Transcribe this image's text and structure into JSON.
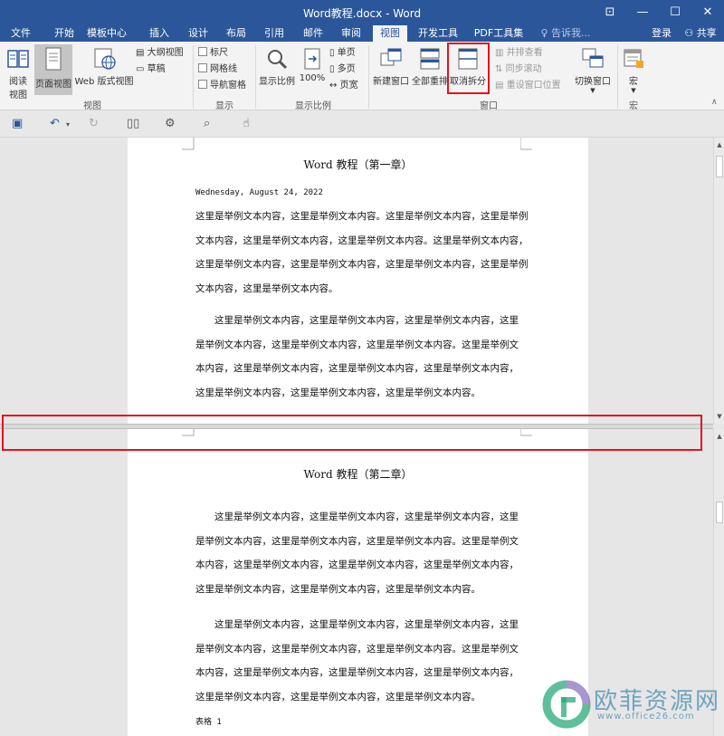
{
  "window": {
    "title": "Word教程.docx - Word",
    "controls": [
      "⊡",
      "—",
      "☐",
      "✕"
    ]
  },
  "tabs": [
    {
      "label": "文件"
    },
    {
      "label": "开始"
    },
    {
      "label": "模板中心"
    },
    {
      "label": "插入"
    },
    {
      "label": "设计"
    },
    {
      "label": "布局"
    },
    {
      "label": "引用"
    },
    {
      "label": "邮件"
    },
    {
      "label": "审阅"
    },
    {
      "label": "视图"
    },
    {
      "label": "开发工具"
    },
    {
      "label": "PDF工具集"
    }
  ],
  "tell_me": "告诉我...",
  "login": "登录",
  "share": "共享",
  "ribbon": {
    "views": {
      "read_mode": "阅读\n视图",
      "read_mode_l1": "阅读",
      "read_mode_l2": "视图",
      "print_layout": "页面视图",
      "web_layout": "Web 版式视图",
      "outline": "大纲视图",
      "draft": "草稿",
      "group": "视图"
    },
    "show": {
      "ruler": "标尺",
      "gridlines": "网格线",
      "nav_pane": "导航窗格",
      "group": "显示"
    },
    "zoom": {
      "zoom": "显示比例",
      "hundred": "100%",
      "one_page": "单页",
      "multi_page": "多页",
      "page_width": "页宽",
      "group": "显示比例"
    },
    "window": {
      "new_window": "新建窗口",
      "arrange_all": "全部重排",
      "remove_split": "取消拆分",
      "side_by_side": "并排查看",
      "sync_scroll": "同步滚动",
      "reset_position": "重设窗口位置",
      "switch_window": "切换窗口",
      "group": "窗口"
    },
    "macros": {
      "macros": "宏",
      "group": "宏"
    }
  },
  "document": {
    "chapter1_title": "Word 教程（第一章）",
    "date": "Wednesday, August 24, 2022",
    "p1": [
      "这里是举例文本内容，这里是举例文本内容。这里是举例文本内容，这里是举例",
      "文本内容，这里是举例文本内容，这里是举例文本内容。这里是举例文本内容，",
      "这里是举例文本内容，这里是举例文本内容，这里是举例文本内容，这里是举例",
      "文本内容，这里是举例文本内容。"
    ],
    "p2": [
      "　　这里是举例文本内容，这里是举例文本内容，这里是举例文本内容，这里",
      "是举例文本内容，这里是举例文本内容，这里是举例文本内容。这里是举例文",
      "本内容，这里是举例文本内容，这里是举例文本内容，这里是举例文本内容，",
      "这里是举例文本内容，这里是举例文本内容，这里是举例文本内容。"
    ],
    "chapter2_title": "Word 教程（第二章）",
    "p3": [
      "　　这里是举例文本内容，这里是举例文本内容，这里是举例文本内容，这里",
      "是举例文本内容，这里是举例文本内容，这里是举例文本内容。这里是举例文",
      "本内容，这里是举例文本内容，这里是举例文本内容，这里是举例文本内容，",
      "这里是举例文本内容，这里是举例文本内容，这里是举例文本内容。"
    ],
    "p4": [
      "　　这里是举例文本内容，这里是举例文本内容，这里是举例文本内容，这里",
      "是举例文本内容，这里是举例文本内容，这里是举例文本内容。这里是举例文",
      "本内容，这里是举例文本内容，这里是举例文本内容，这里是举例文本内容，",
      "这里是举例文本内容，这里是举例文本内容，这里是举例文本内容。"
    ],
    "caption": "表格 1"
  },
  "watermark": {
    "text": "欧菲资源网",
    "url": "www.office26.com"
  },
  "colors": {
    "brand": "#2b579a",
    "highlight": "#e0141e"
  }
}
